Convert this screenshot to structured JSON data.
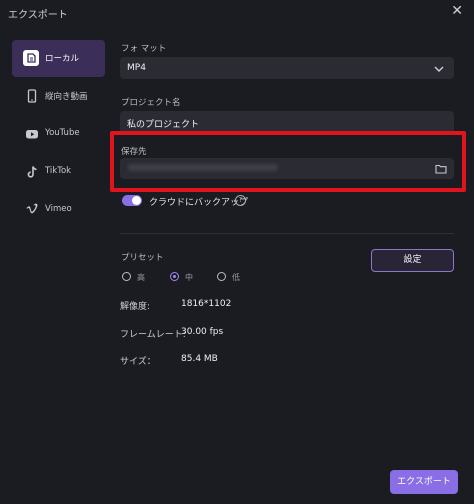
{
  "window": {
    "title": "エクスポート"
  },
  "sidebar": {
    "items": [
      {
        "label": "ローカル",
        "icon": "local-file-icon",
        "active": true
      },
      {
        "label": "縦向き動画",
        "icon": "phone-icon",
        "active": false
      },
      {
        "label": "YouTube",
        "icon": "youtube-icon",
        "active": false
      },
      {
        "label": "TikTok",
        "icon": "tiktok-icon",
        "active": false
      },
      {
        "label": "Vimeo",
        "icon": "vimeo-icon",
        "active": false
      }
    ]
  },
  "format": {
    "label": "フォ マット",
    "value": "MP4"
  },
  "project_name": {
    "label": "プロジェクト名",
    "value": "私のプロジェクト"
  },
  "save_location": {
    "label": "保存先",
    "value": ""
  },
  "cloud_backup": {
    "label": "クラウドにバックアップ",
    "enabled": true
  },
  "preset": {
    "label": "プリセット",
    "options": [
      {
        "label": "高",
        "selected": false
      },
      {
        "label": "中",
        "selected": true
      },
      {
        "label": "低",
        "selected": false
      }
    ],
    "settings_button": "設定"
  },
  "info": {
    "resolution_label": "解像度:",
    "resolution_value": "1816*1102",
    "framerate_label": "フレームレート:",
    "framerate_value": "30.00 fps",
    "size_label": "サイズ：",
    "size_value": "85.4 MB"
  },
  "export_button": "エクスポート",
  "colors": {
    "accent": "#8a6ee6",
    "highlight": "#e0141c",
    "background": "#1b1b22",
    "field": "#2b2b33"
  }
}
